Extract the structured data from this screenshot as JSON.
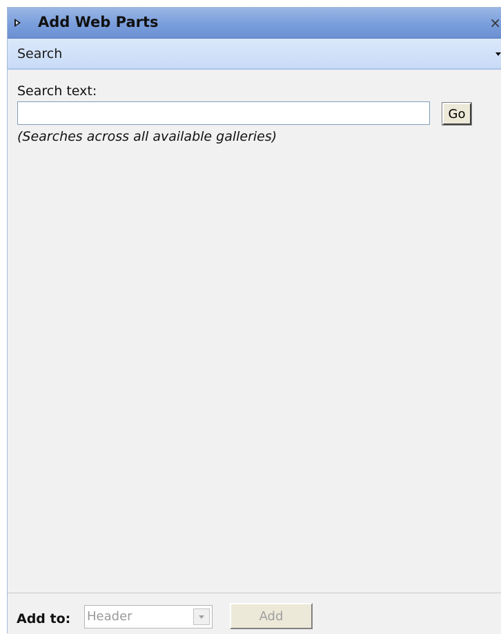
{
  "title_bar": {
    "title": "Add Web Parts",
    "close_glyph": "×",
    "expand_icon": "triangle-right-icon"
  },
  "section": {
    "label": "Search",
    "dropdown_icon": "caret-down-icon"
  },
  "search": {
    "label": "Search text:",
    "input_value": "",
    "go_label": "Go",
    "hint": "(Searches across all available galleries)"
  },
  "footer": {
    "add_to_label": "Add to:",
    "zone_selected": "Header",
    "add_label": "Add",
    "controls_disabled": true
  },
  "colors": {
    "title_bar": "#7a9edc",
    "section_bar": "#c8dbf7",
    "panel_background": "#f1f1f1",
    "disabled_text": "#a0a0a0"
  }
}
